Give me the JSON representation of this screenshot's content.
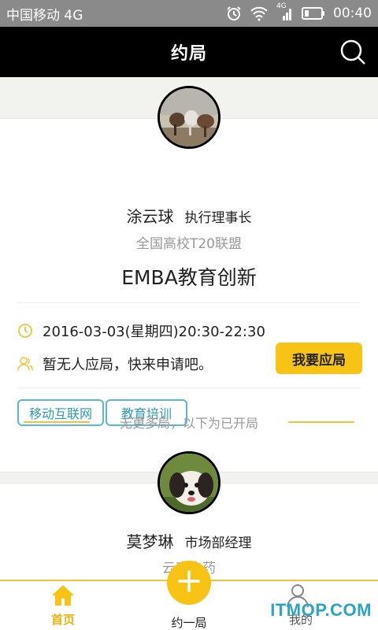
{
  "status": {
    "carrier": "中国移动 4G",
    "time": "00:40",
    "net_label": "4G"
  },
  "header": {
    "title": "约局"
  },
  "card1": {
    "name": "涂云球",
    "role": "执行理事长",
    "org": "全国高校T20联盟",
    "subject": "EMBA教育创新",
    "datetime": "2016-03-03(星期四)20:30-22:30",
    "attendees": "暂无人应局，快来申请吧。",
    "apply_label": "我要应局",
    "tags": [
      "移动互联网",
      "教育培训"
    ]
  },
  "separator": {
    "text": "无更多局，以下为已开局"
  },
  "card2": {
    "name": "莫梦琳",
    "role": "市场部经理",
    "org": "云南白药"
  },
  "nav": {
    "home": "首页",
    "add": "约一局",
    "mine": "我的"
  },
  "watermark": "ITMOP.COM",
  "colors": {
    "accent": "#f7c416",
    "tag": "#2c9bb3",
    "header": "#000000"
  }
}
